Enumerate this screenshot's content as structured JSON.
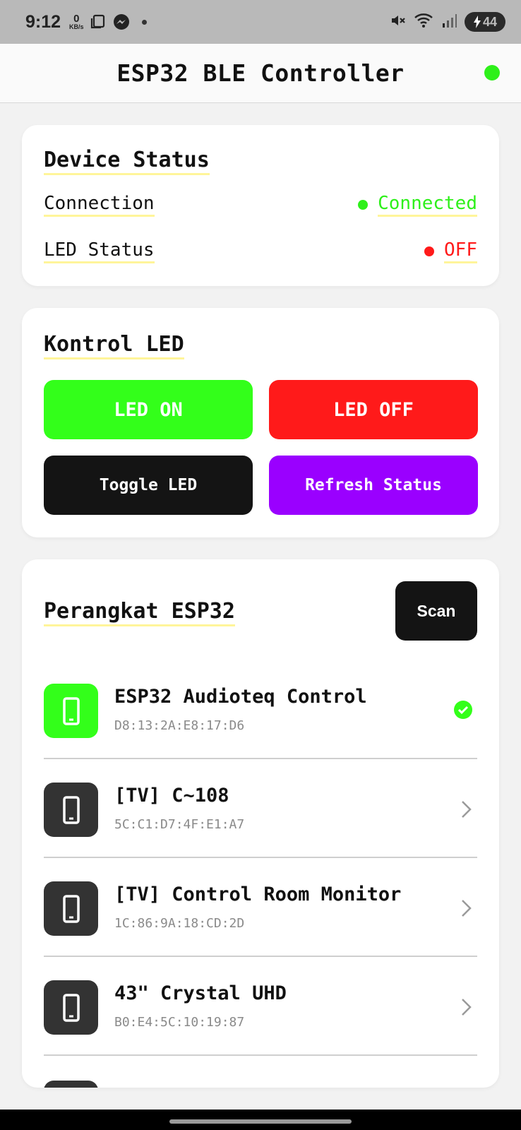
{
  "status_bar": {
    "time": "9:12",
    "net_speed_value": "0",
    "net_speed_unit": "KB/s",
    "battery": "44",
    "icons": [
      "screenshot-icon",
      "messenger-icon",
      "mute-icon",
      "wifi-icon",
      "signal-icon",
      "battery-charging-icon"
    ]
  },
  "app_bar": {
    "title": "ESP32 BLE Controller",
    "connection_indicator_color": "#2ef01a"
  },
  "device_status": {
    "title": "Device Status",
    "connection_label": "Connection",
    "connection_value": "Connected",
    "connection_color": "#2ef01a",
    "led_label": "LED Status",
    "led_value": "OFF",
    "led_color": "#ff1a1a"
  },
  "led_control": {
    "title": "Kontrol LED",
    "buttons": {
      "on": "LED ON",
      "off": "LED OFF",
      "toggle": "Toggle LED",
      "refresh": "Refresh Status"
    },
    "colors": {
      "on": "#33ff1a",
      "off": "#ff1a1a",
      "toggle": "#141414",
      "refresh": "#9a00ff"
    }
  },
  "devices": {
    "title": "Perangkat ESP32",
    "scan_label": "Scan",
    "items": [
      {
        "name": "ESP32 Audioteq Control",
        "mac": "D8:13:2A:E8:17:D6",
        "connected": true
      },
      {
        "name": "[TV] C~108",
        "mac": "5C:C1:D7:4F:E1:A7",
        "connected": false
      },
      {
        "name": "[TV] Control Room Monitor",
        "mac": "1C:86:9A:18:CD:2D",
        "connected": false
      },
      {
        "name": "43\" Crystal UHD",
        "mac": "B0:E4:5C:10:19:87",
        "connected": false
      }
    ]
  }
}
